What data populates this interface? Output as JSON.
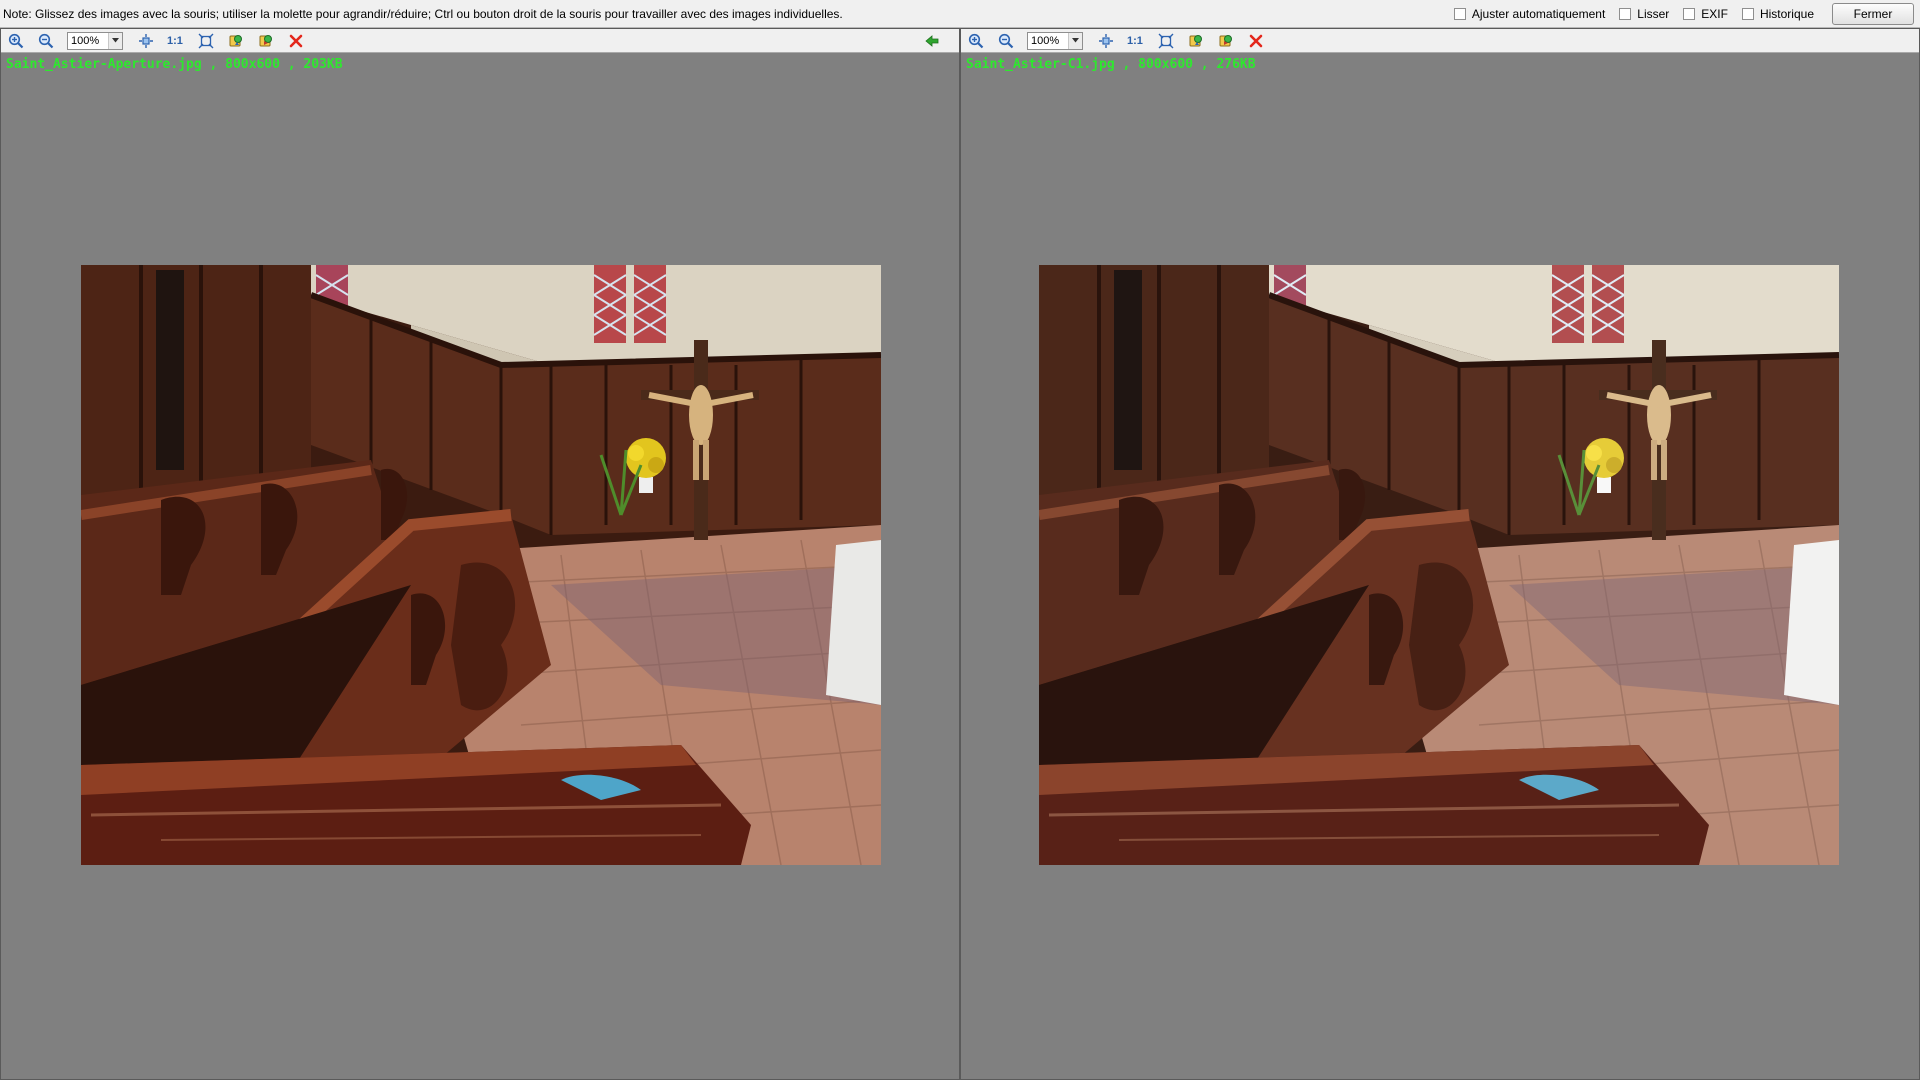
{
  "topbar": {
    "note": "Note: Glissez des images avec la souris; utiliser la molette pour agrandir/réduire; Ctrl ou bouton droit de la souris pour travailler avec des images individuelles.",
    "options": {
      "auto_fit": "Ajuster automatiquement",
      "smooth": "Lisser",
      "exif": "EXIF",
      "history": "Historique"
    },
    "close_label": "Fermer"
  },
  "left_panel": {
    "zoom": "100%",
    "actual_size": "1:1",
    "file_info": "Saint_Astier-Aperture.jpg , 800x600 , 203KB"
  },
  "right_panel": {
    "zoom": "100%",
    "actual_size": "1:1",
    "file_info": "Saint_Astier-C1.jpg , 800x600 , 276KB"
  },
  "colors": {
    "file_label": "#2ee82e",
    "panel_bg": "#808080",
    "toolbar_bg": "#f0f0f0"
  },
  "icons": [
    "zoom-in-icon",
    "zoom-out-icon",
    "fit-icon",
    "fullscreen-icon",
    "rotate-left-icon",
    "rotate-right-icon",
    "close-x-icon",
    "back-arrow-icon"
  ]
}
